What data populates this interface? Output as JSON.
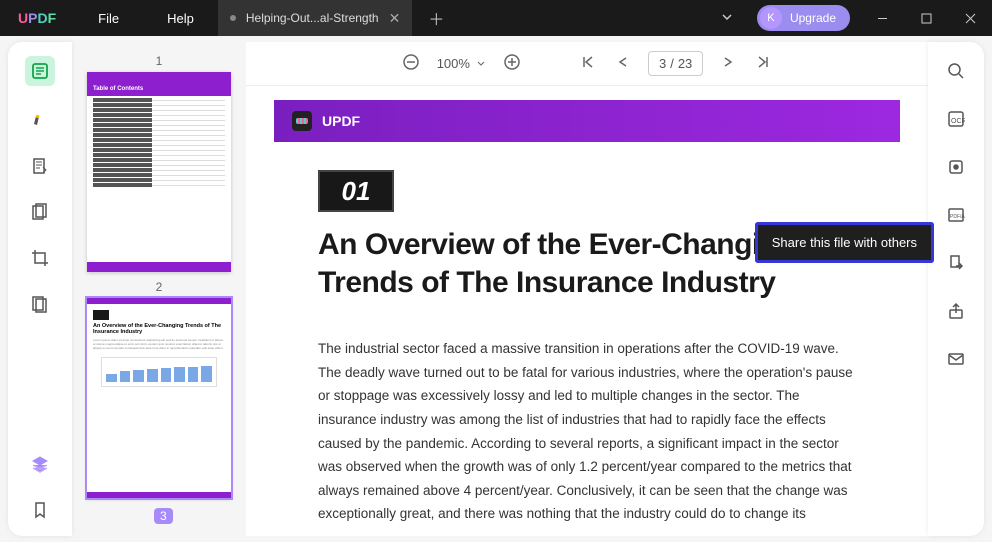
{
  "titlebar": {
    "logo": [
      "U",
      "P",
      "D",
      "F"
    ],
    "menu": [
      "File",
      "Help"
    ],
    "tab": "Helping-Out...al-Strength",
    "upgrade_badge": "K",
    "upgrade": "Upgrade"
  },
  "toolbar": {
    "zoom": "100%",
    "page_current": "3",
    "page_sep": "/",
    "page_total": "23"
  },
  "thumbs": {
    "n1": "1",
    "n2": "2",
    "n3": "3",
    "toc": "Table of Contents",
    "t2_title": "An Overview of the Ever-Changing Trends of The Insurance Industry"
  },
  "doc": {
    "brand": "UPDF",
    "num": "01",
    "title": "An Overview of the Ever-Changing Trends of The Insurance Industry",
    "para": "The industrial sector faced a massive transition in operations after the COVID-19 wave. The deadly wave turned out to be fatal for various industries, where the operation's pause or stoppage was excessively lossy and led to multiple changes in the sector. The insurance industry was among the list of industries that had to rapidly face the effects caused by the pandemic. According to several reports, a significant impact in the sector was observed when the growth was of only 1.2 percent/year compared to the metrics that always remained above 4 percent/year. Conclusively, it can be seen that the change was exceptionally great, and there was nothing that the industry could do to change its"
  },
  "tooltip": {
    "share": "Share this file with others"
  },
  "right_icons": [
    "search",
    "ocr",
    "flatten",
    "pdfa",
    "export",
    "share",
    "mail"
  ]
}
